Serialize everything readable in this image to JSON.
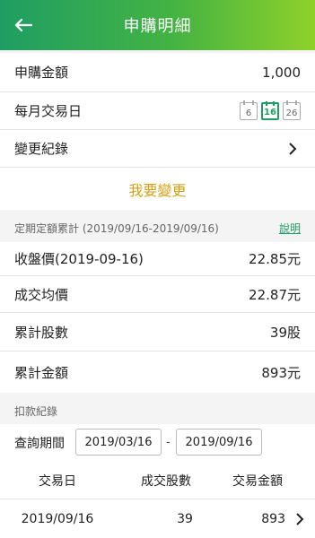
{
  "header": {
    "title": "申購明細"
  },
  "subscription": {
    "amount_label": "申購金額",
    "amount_value": "1,000",
    "trade_day_label": "每月交易日",
    "trade_days": [
      "6",
      "16",
      "26"
    ],
    "selected_day": "16",
    "change_log_label": "變更紀錄",
    "change_button": "我要變更"
  },
  "summary": {
    "title": "定期定額累計 (2019/09/16-2019/09/16)",
    "help_link": "說明",
    "rows": [
      {
        "label": "收盤價(2019-09-16)",
        "value": "22.85元"
      },
      {
        "label": "成交均價",
        "value": "22.87元"
      },
      {
        "label": "累計股數",
        "value": "39股"
      },
      {
        "label": "累計金額",
        "value": "893元"
      }
    ]
  },
  "debit": {
    "title": "扣款紀錄",
    "query_label": "查詢期間",
    "date_from": "2019/03/16",
    "date_to": "2019/09/16",
    "separator": "-",
    "columns": [
      "交易日",
      "成交股數",
      "交易金額"
    ],
    "records": [
      {
        "date": "2019/09/16",
        "shares": "39",
        "amount": "893"
      }
    ]
  },
  "colors": {
    "brand_green": "#1f9e63",
    "accent_gold": "#d4a017"
  },
  "icons": {
    "back": "back-arrow-icon",
    "chevron": "chevron-right-icon",
    "calendar": "calendar-day-icon"
  }
}
